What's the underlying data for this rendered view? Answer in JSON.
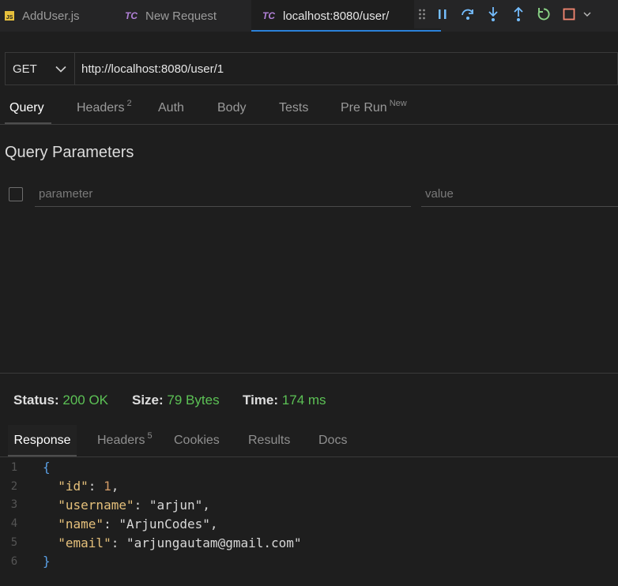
{
  "editor_tabs": [
    {
      "label": "AddUser.js",
      "badge": "JS"
    },
    {
      "label": "New Request",
      "badge": "TC"
    },
    {
      "label": "localhost:8080/user/",
      "badge": "TC"
    }
  ],
  "request": {
    "method": "GET",
    "url": "http://localhost:8080/user/1"
  },
  "request_tabs": [
    {
      "label": "Query"
    },
    {
      "label": "Headers",
      "badge": "2"
    },
    {
      "label": "Auth"
    },
    {
      "label": "Body"
    },
    {
      "label": "Tests"
    },
    {
      "label": "Pre Run",
      "badge": "New"
    }
  ],
  "query": {
    "title": "Query Parameters",
    "param_placeholder": "parameter",
    "value_placeholder": "value"
  },
  "status": {
    "status_label": "Status:",
    "status_value": "200 OK",
    "size_label": "Size:",
    "size_value": "79 Bytes",
    "time_label": "Time:",
    "time_value": "174 ms"
  },
  "response_tabs": [
    {
      "label": "Response"
    },
    {
      "label": "Headers",
      "badge": "5"
    },
    {
      "label": "Cookies"
    },
    {
      "label": "Results"
    },
    {
      "label": "Docs"
    }
  ],
  "response_body": {
    "line_numbers": [
      "1",
      "2",
      "3",
      "4",
      "5",
      "6"
    ],
    "open_brace": "{",
    "close_brace": "}",
    "fields": [
      {
        "key": "\"id\"",
        "value": "1",
        "suffix": ","
      },
      {
        "key": "\"username\"",
        "value": "\"arjun\"",
        "suffix": ","
      },
      {
        "key": "\"name\"",
        "value": "\"ArjunCodes\"",
        "suffix": ","
      },
      {
        "key": "\"email\"",
        "value": "\"arjungautam@gmail.com\"",
        "suffix": ""
      }
    ]
  },
  "icons": {
    "drag": "drag-handle-icon",
    "pause": "pause-icon",
    "step_over": "step-over-icon",
    "step_into": "step-into-icon",
    "step_out": "step-out-icon",
    "restart": "restart-icon",
    "stop": "stop-icon",
    "dropdown": "chevron-down-icon"
  },
  "colors": {
    "accent_tab": "#2b82d9",
    "success": "#5cc155",
    "json_key": "#e5c07b",
    "json_number": "#d19a66",
    "brace": "#5aa0e6"
  }
}
